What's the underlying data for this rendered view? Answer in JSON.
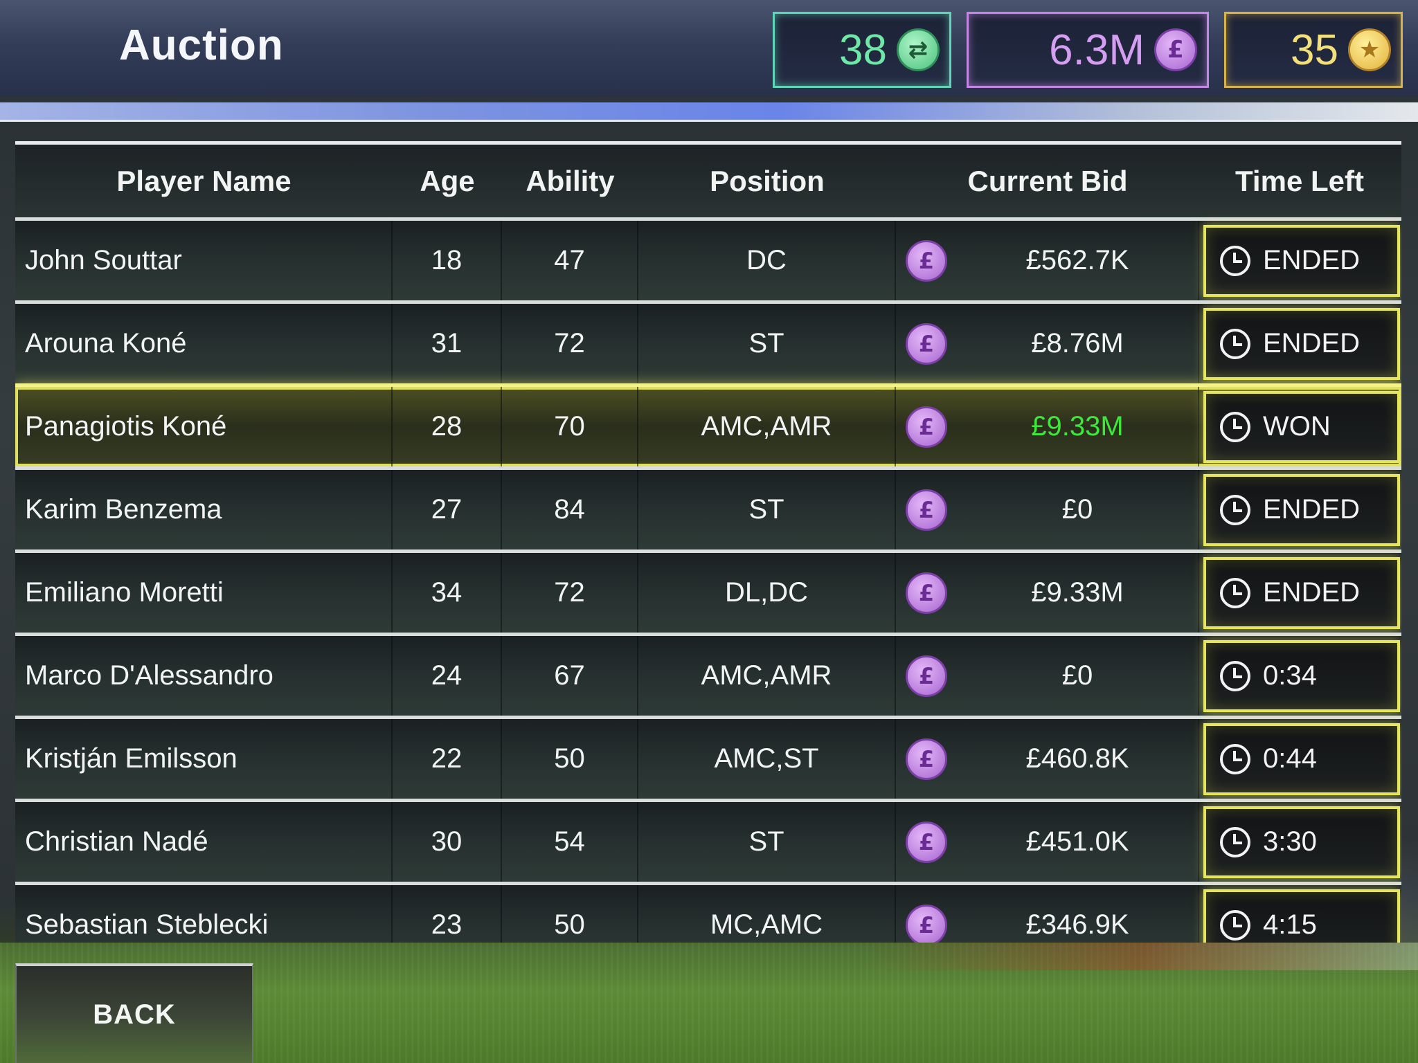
{
  "header": {
    "title": "Auction",
    "transfers": "38",
    "money": "6.3M",
    "stars": "35"
  },
  "colors": {
    "transfer_accent": "#5fd6b8",
    "money_accent": "#c487e6",
    "stars_accent": "#d8b24a",
    "time_box_border": "#e6e65e",
    "won_bid": "#3ee83a"
  },
  "icons": {
    "transfer": "transfer-coin-icon",
    "pound": "pound-coin-icon",
    "star": "star-coin-icon",
    "clock": "clock-icon",
    "pound_glyph": "£",
    "star_glyph": "★",
    "transfer_glyph": "⇄"
  },
  "table": {
    "headers": [
      "Player Name",
      "Age",
      "Ability",
      "Position",
      "Current Bid",
      "Time Left"
    ],
    "rows": [
      {
        "name": "John Souttar",
        "age": "18",
        "ability": "47",
        "position": "DC",
        "bid": "£562.7K",
        "time": "ENDED"
      },
      {
        "name": "Arouna Koné",
        "age": "31",
        "ability": "72",
        "position": "ST",
        "bid": "£8.76M",
        "time": "ENDED"
      },
      {
        "name": "Panagiotis Koné",
        "age": "28",
        "ability": "70",
        "position": "AMC,AMR",
        "bid": "£9.33M",
        "time": "WON"
      },
      {
        "name": "Karim Benzema",
        "age": "27",
        "ability": "84",
        "position": "ST",
        "bid": "£0",
        "time": "ENDED"
      },
      {
        "name": "Emiliano Moretti",
        "age": "34",
        "ability": "72",
        "position": "DL,DC",
        "bid": "£9.33M",
        "time": "ENDED"
      },
      {
        "name": "Marco D'Alessandro",
        "age": "24",
        "ability": "67",
        "position": "AMC,AMR",
        "bid": "£0",
        "time": "0:34"
      },
      {
        "name": "Kristján Emilsson",
        "age": "22",
        "ability": "50",
        "position": "AMC,ST",
        "bid": "£460.8K",
        "time": "0:44"
      },
      {
        "name": "Christian Nadé",
        "age": "30",
        "ability": "54",
        "position": "ST",
        "bid": "£451.0K",
        "time": "3:30"
      },
      {
        "name": "Sebastian Steblecki",
        "age": "23",
        "ability": "50",
        "position": "MC,AMC",
        "bid": "£346.9K",
        "time": "4:15"
      }
    ]
  },
  "footer": {
    "back_label": "BACK"
  }
}
